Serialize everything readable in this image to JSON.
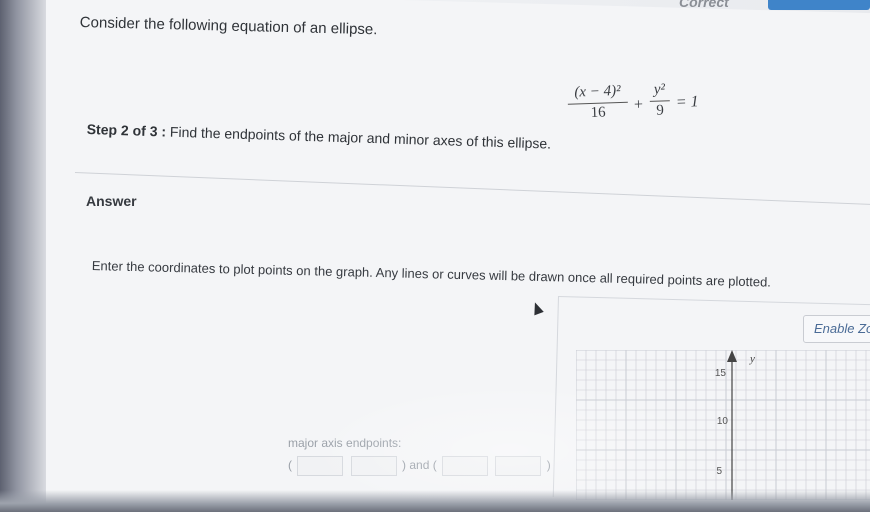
{
  "header": {
    "status_text": "Correct"
  },
  "problem": {
    "question": "Consider the following equation of an ellipse.",
    "equation": {
      "term1_numerator": "(x − 4)²",
      "term1_denominator": "16",
      "plus": "+",
      "term2_numerator": "y²",
      "term2_denominator": "9",
      "equals": "= 1"
    },
    "step_label": "Step 2 of 3 :",
    "step_text": " Find the endpoints of the major and minor axes of this ellipse."
  },
  "answer": {
    "heading": "Answer",
    "instructions": "Enter the coordinates to plot points on the graph. Any lines or curves will be drawn once all required points are plotted.",
    "enable_zoom_label": "Enable Zoom",
    "major_axis_label": "major axis endpoints:",
    "open_paren": "(",
    "and_text": ") and (",
    "close_paren": ")",
    "point1_x": "",
    "point1_y": "",
    "point2_x": "",
    "point2_y": ""
  },
  "graph": {
    "y_axis_label": "y",
    "y_ticks": [
      "15",
      "10",
      "5"
    ]
  },
  "colors": {
    "accent_blue": "#3f84c9",
    "grid_line": "#c9ccd3",
    "axis": "#444444"
  }
}
